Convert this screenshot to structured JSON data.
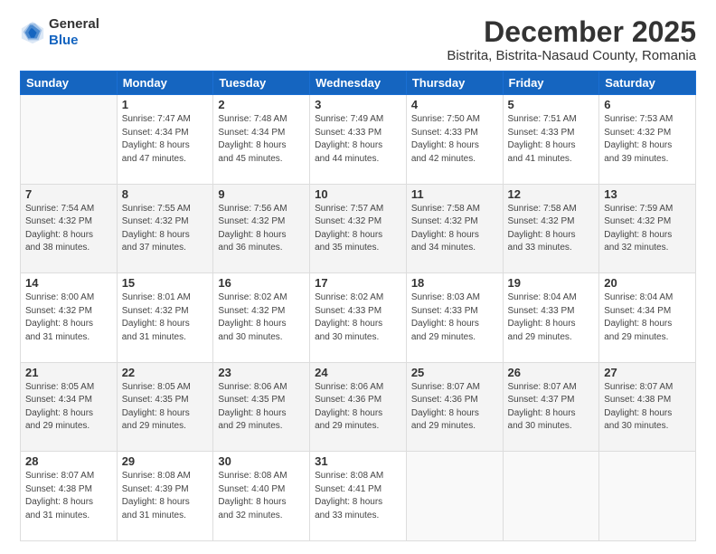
{
  "logo": {
    "general": "General",
    "blue": "Blue"
  },
  "header": {
    "title": "December 2025",
    "subtitle": "Bistrita, Bistrita-Nasaud County, Romania"
  },
  "days_of_week": [
    "Sunday",
    "Monday",
    "Tuesday",
    "Wednesday",
    "Thursday",
    "Friday",
    "Saturday"
  ],
  "weeks": [
    [
      {
        "day": "",
        "info": ""
      },
      {
        "day": "1",
        "info": "Sunrise: 7:47 AM\nSunset: 4:34 PM\nDaylight: 8 hours\nand 47 minutes."
      },
      {
        "day": "2",
        "info": "Sunrise: 7:48 AM\nSunset: 4:34 PM\nDaylight: 8 hours\nand 45 minutes."
      },
      {
        "day": "3",
        "info": "Sunrise: 7:49 AM\nSunset: 4:33 PM\nDaylight: 8 hours\nand 44 minutes."
      },
      {
        "day": "4",
        "info": "Sunrise: 7:50 AM\nSunset: 4:33 PM\nDaylight: 8 hours\nand 42 minutes."
      },
      {
        "day": "5",
        "info": "Sunrise: 7:51 AM\nSunset: 4:33 PM\nDaylight: 8 hours\nand 41 minutes."
      },
      {
        "day": "6",
        "info": "Sunrise: 7:53 AM\nSunset: 4:32 PM\nDaylight: 8 hours\nand 39 minutes."
      }
    ],
    [
      {
        "day": "7",
        "info": "Sunrise: 7:54 AM\nSunset: 4:32 PM\nDaylight: 8 hours\nand 38 minutes."
      },
      {
        "day": "8",
        "info": "Sunrise: 7:55 AM\nSunset: 4:32 PM\nDaylight: 8 hours\nand 37 minutes."
      },
      {
        "day": "9",
        "info": "Sunrise: 7:56 AM\nSunset: 4:32 PM\nDaylight: 8 hours\nand 36 minutes."
      },
      {
        "day": "10",
        "info": "Sunrise: 7:57 AM\nSunset: 4:32 PM\nDaylight: 8 hours\nand 35 minutes."
      },
      {
        "day": "11",
        "info": "Sunrise: 7:58 AM\nSunset: 4:32 PM\nDaylight: 8 hours\nand 34 minutes."
      },
      {
        "day": "12",
        "info": "Sunrise: 7:58 AM\nSunset: 4:32 PM\nDaylight: 8 hours\nand 33 minutes."
      },
      {
        "day": "13",
        "info": "Sunrise: 7:59 AM\nSunset: 4:32 PM\nDaylight: 8 hours\nand 32 minutes."
      }
    ],
    [
      {
        "day": "14",
        "info": "Sunrise: 8:00 AM\nSunset: 4:32 PM\nDaylight: 8 hours\nand 31 minutes."
      },
      {
        "day": "15",
        "info": "Sunrise: 8:01 AM\nSunset: 4:32 PM\nDaylight: 8 hours\nand 31 minutes."
      },
      {
        "day": "16",
        "info": "Sunrise: 8:02 AM\nSunset: 4:32 PM\nDaylight: 8 hours\nand 30 minutes."
      },
      {
        "day": "17",
        "info": "Sunrise: 8:02 AM\nSunset: 4:33 PM\nDaylight: 8 hours\nand 30 minutes."
      },
      {
        "day": "18",
        "info": "Sunrise: 8:03 AM\nSunset: 4:33 PM\nDaylight: 8 hours\nand 29 minutes."
      },
      {
        "day": "19",
        "info": "Sunrise: 8:04 AM\nSunset: 4:33 PM\nDaylight: 8 hours\nand 29 minutes."
      },
      {
        "day": "20",
        "info": "Sunrise: 8:04 AM\nSunset: 4:34 PM\nDaylight: 8 hours\nand 29 minutes."
      }
    ],
    [
      {
        "day": "21",
        "info": "Sunrise: 8:05 AM\nSunset: 4:34 PM\nDaylight: 8 hours\nand 29 minutes."
      },
      {
        "day": "22",
        "info": "Sunrise: 8:05 AM\nSunset: 4:35 PM\nDaylight: 8 hours\nand 29 minutes."
      },
      {
        "day": "23",
        "info": "Sunrise: 8:06 AM\nSunset: 4:35 PM\nDaylight: 8 hours\nand 29 minutes."
      },
      {
        "day": "24",
        "info": "Sunrise: 8:06 AM\nSunset: 4:36 PM\nDaylight: 8 hours\nand 29 minutes."
      },
      {
        "day": "25",
        "info": "Sunrise: 8:07 AM\nSunset: 4:36 PM\nDaylight: 8 hours\nand 29 minutes."
      },
      {
        "day": "26",
        "info": "Sunrise: 8:07 AM\nSunset: 4:37 PM\nDaylight: 8 hours\nand 30 minutes."
      },
      {
        "day": "27",
        "info": "Sunrise: 8:07 AM\nSunset: 4:38 PM\nDaylight: 8 hours\nand 30 minutes."
      }
    ],
    [
      {
        "day": "28",
        "info": "Sunrise: 8:07 AM\nSunset: 4:38 PM\nDaylight: 8 hours\nand 31 minutes."
      },
      {
        "day": "29",
        "info": "Sunrise: 8:08 AM\nSunset: 4:39 PM\nDaylight: 8 hours\nand 31 minutes."
      },
      {
        "day": "30",
        "info": "Sunrise: 8:08 AM\nSunset: 4:40 PM\nDaylight: 8 hours\nand 32 minutes."
      },
      {
        "day": "31",
        "info": "Sunrise: 8:08 AM\nSunset: 4:41 PM\nDaylight: 8 hours\nand 33 minutes."
      },
      {
        "day": "",
        "info": ""
      },
      {
        "day": "",
        "info": ""
      },
      {
        "day": "",
        "info": ""
      }
    ]
  ]
}
